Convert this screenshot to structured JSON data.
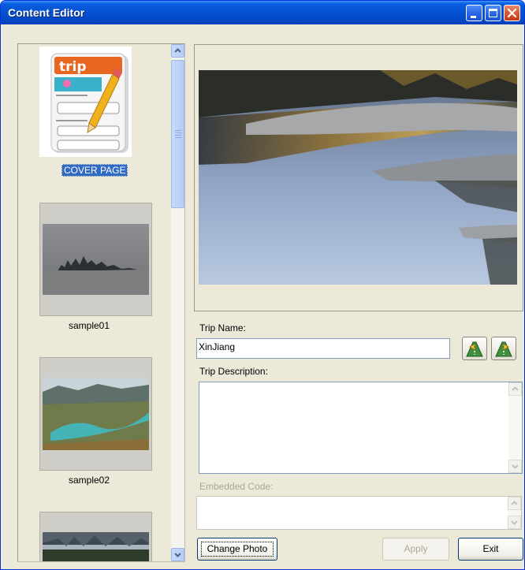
{
  "window": {
    "title": "Content Editor",
    "controls": {
      "minimize": "minimize-icon",
      "maximize": "maximize-icon",
      "close": "close-icon"
    }
  },
  "pages_list": {
    "items": [
      {
        "label": "COVER PAGE",
        "selected": true,
        "icon": "trip-cover-icon"
      },
      {
        "label": "sample01",
        "selected": false
      },
      {
        "label": "sample02",
        "selected": false
      },
      {
        "label": "",
        "selected": false
      }
    ],
    "cover_icon_text": "trip"
  },
  "form": {
    "trip_name_label": "Trip Name:",
    "trip_name_value": "XinJiang",
    "trip_description_label": "Trip Description:",
    "trip_description_value": "",
    "embedded_code_label": "Embedded Code:",
    "embedded_code_value": ""
  },
  "buttons": {
    "change_photo": "Change Photo",
    "apply": "Apply",
    "exit": "Exit",
    "icon_left": "move-left-icon",
    "icon_right": "move-right-icon"
  },
  "colors": {
    "titlebar": "#0554d4",
    "selection": "#316ac5",
    "window_bg": "#ece9d8"
  }
}
